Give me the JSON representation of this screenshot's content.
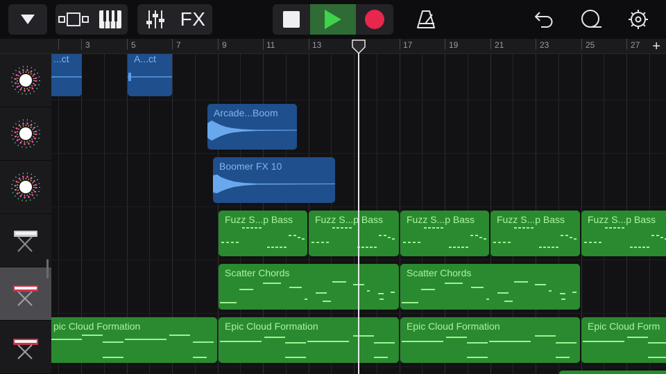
{
  "toolbar": {
    "fx_label": "FX",
    "icons": [
      "chevron-down-icon",
      "view-toggle-icon",
      "keyboard-icon",
      "mixer-icon",
      "stop-icon",
      "play-icon",
      "record-icon",
      "metronome-icon",
      "undo-icon",
      "loop-icon",
      "settings-icon"
    ],
    "colors": {
      "play_active_bg": "#2f6b34",
      "play_green": "#3fd24c",
      "record_red": "#e8264e"
    }
  },
  "ruler": {
    "bar_numbers": [
      "3",
      "5",
      "7",
      "9",
      "11",
      "13",
      "15",
      "17",
      "19",
      "21",
      "23",
      "25",
      "27"
    ],
    "add_label": "+"
  },
  "tracks": [
    {
      "name": "fx-sparkle-1",
      "icon": "sparkle-icon"
    },
    {
      "name": "fx-sparkle-2",
      "icon": "sparkle-icon"
    },
    {
      "name": "fx-sparkle-3",
      "icon": "sparkle-icon"
    },
    {
      "name": "synth-keyboard",
      "icon": "synth-keyboard-icon"
    },
    {
      "name": "red-keyboard",
      "icon": "red-keyboard-icon",
      "selected": true
    },
    {
      "name": "red-keyboard-2",
      "icon": "red-keyboard-icon"
    }
  ],
  "regions": {
    "r0": {
      "label": "...ct",
      "type": "audio"
    },
    "r1": {
      "label": "A...ct",
      "type": "audio"
    },
    "r2": {
      "label": "Arcade...Boom",
      "type": "audio"
    },
    "r3": {
      "label": "Boomer FX 10",
      "type": "audio"
    },
    "r4": {
      "label": "Fuzz S...p Bass",
      "type": "midi"
    },
    "r5": {
      "label": "Fuzz S...p Bass",
      "type": "midi"
    },
    "r6": {
      "label": "Fuzz S...p Bass",
      "type": "midi"
    },
    "r7": {
      "label": "Fuzz S...p Bass",
      "type": "midi"
    },
    "r8": {
      "label": "Fuzz S...p Bass",
      "type": "midi"
    },
    "r9": {
      "label": "Scatter Chords",
      "type": "midi"
    },
    "r10": {
      "label": "Scatter Chords",
      "type": "midi"
    },
    "r11": {
      "label": "pic Cloud Formation",
      "type": "midi"
    },
    "r12": {
      "label": "Epic Cloud Formation",
      "type": "midi"
    },
    "r13": {
      "label": "Epic Cloud Formation",
      "type": "midi"
    },
    "r14": {
      "label": "Epic Cloud Form",
      "type": "midi"
    }
  },
  "playhead": {
    "bar": 15
  }
}
